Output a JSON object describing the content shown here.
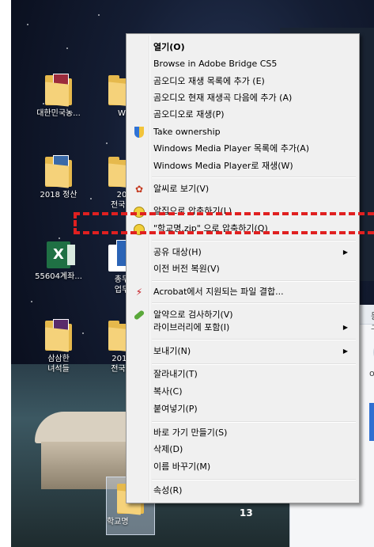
{
  "desktop": {
    "icons": [
      {
        "label": "대한민국농..."
      },
      {
        "label": "2018 정산"
      },
      {
        "label": "55604계좌..."
      },
      {
        "label": "삼삼한\n녀석들"
      }
    ],
    "second_column": [
      {
        "label": "W"
      },
      {
        "label": "20\n전국..."
      },
      {
        "label": "총무\n업무"
      },
      {
        "label": "2019\n전국초"
      }
    ],
    "selected_folder_label": "학교명",
    "taskbar_number": "13",
    "right_fragments": {
      "text1": "등구",
      "text2": "ook"
    }
  },
  "context_menu": {
    "items": [
      {
        "label": "열기(O)",
        "bold": true
      },
      {
        "label": "Browse in Adobe Bridge CS5"
      },
      {
        "label": "곰오디오 재생 목록에 추가 (E)"
      },
      {
        "label": "곰오디오 현재 재생곡 다음에 추가 (A)"
      },
      {
        "label": "곰오디오로 재생(P)"
      },
      {
        "label": "Take ownership",
        "icon": "shield-icon"
      },
      {
        "label": "Windows Media Player 목록에 추가(A)"
      },
      {
        "label": "Windows Media Player로 재생(W)"
      },
      {
        "label": "알씨로 보기(V)",
        "icon": "alsee-icon"
      },
      {
        "label": "알집으로 압축하기(L)",
        "icon": "alzip-icon"
      },
      {
        "label": "\"학교명.zip\" 으로 압축하기(Q)",
        "icon": "alzip-icon"
      },
      {
        "label": "공유 대상(H)",
        "submenu": true
      },
      {
        "label": "이전 버전 복원(V)"
      },
      {
        "label": "Acrobat에서 지원되는 파일 결합...",
        "icon": "acrobat-icon"
      },
      {
        "label": "알약으로 검사하기(V)",
        "icon": "alyac-icon"
      },
      {
        "label": "라이브러리에 포함(I)",
        "submenu": true
      },
      {
        "label": "보내기(N)",
        "submenu": true
      },
      {
        "label": "잘라내기(T)"
      },
      {
        "label": "복사(C)"
      },
      {
        "label": "붙여넣기(P)"
      },
      {
        "label": "바로 가기 만들기(S)"
      },
      {
        "label": "삭제(D)"
      },
      {
        "label": "이름 바꾸기(M)"
      },
      {
        "label": "속성(R)"
      }
    ],
    "submenu_arrow": "▶"
  },
  "highlight": {
    "color": "#e02020"
  }
}
